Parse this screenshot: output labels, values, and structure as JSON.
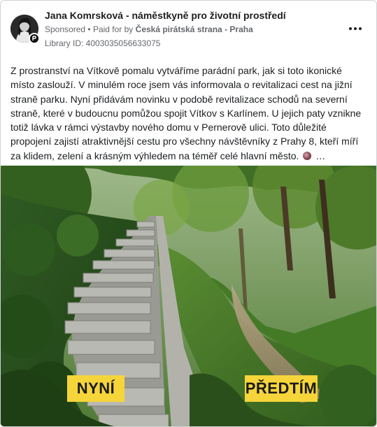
{
  "post": {
    "author": "Jana Komrsková - náměstkyně pro životní prostředí",
    "sponsored": "Sponsored",
    "separator": "•",
    "paid_for_prefix": "Paid for by",
    "paid_for_by": "Česká pirátská strana - Praha",
    "library_id": "Library ID: 4003035056633075",
    "more_icon": "more-horizontal-icon",
    "text_main": "Z prostranství na Vítkově pomalu vytváříme parádní park, jak si toto ikonické místo zaslouží. V minulém roce jsem vás informovala o revitalizaci cest na jižní straně parku. Nyní přidávám novinku v podobě revitalizace schodů na severní straně, které v budoucnu pomůžou spojit Vítkov s Karlínem. U jejich paty vznikne totiž lávka v rámci výstavby nového domu v Pernerově ulici. Toto důležité propojení zajistí atraktivnější cestu pro všechny návštěvníky z Prahy 8, kteří míří za klidem, zelení a krásným výhledem na téměř celé hlavní město.",
    "text_ellipsis": "…",
    "emoji_icon": "globe-emoji-icon"
  },
  "media": {
    "label_now": "NYNÍ",
    "label_before": "PŘEDTÍM",
    "label_color": "#f5d53a"
  }
}
